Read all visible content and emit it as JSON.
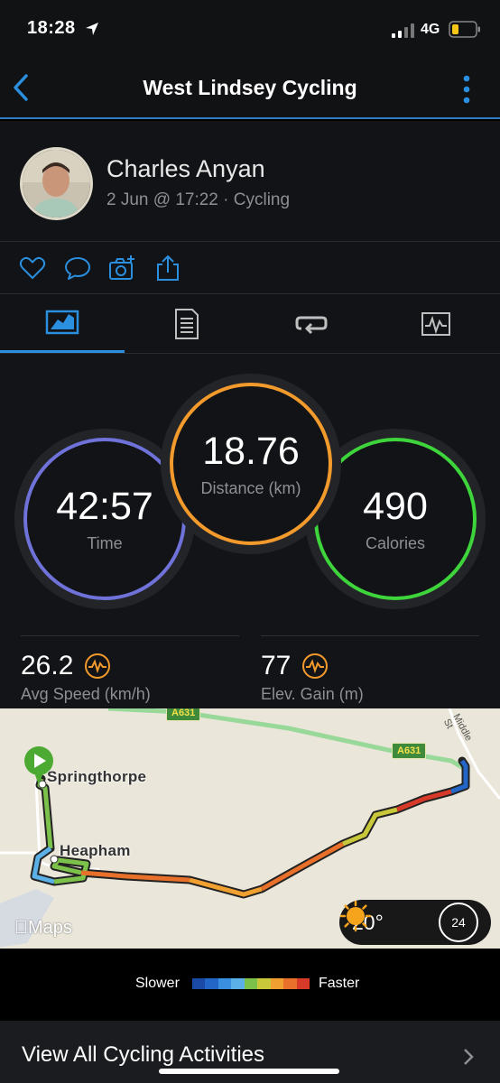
{
  "status_bar": {
    "time": "18:28",
    "network": "4G"
  },
  "nav": {
    "title": "West Lindsey Cycling"
  },
  "profile": {
    "name": "Charles Anyan",
    "meta": "2 Jun @ 17:22 · Cycling"
  },
  "actions": [
    {
      "icon": "heart-icon"
    },
    {
      "icon": "comment-icon"
    },
    {
      "icon": "add-photo-icon"
    },
    {
      "icon": "share-icon"
    }
  ],
  "tabs": [
    {
      "icon": "overview-icon",
      "active": true
    },
    {
      "icon": "details-icon",
      "active": false
    },
    {
      "icon": "laps-icon",
      "active": false
    },
    {
      "icon": "charts-icon",
      "active": false
    }
  ],
  "stats": {
    "time": {
      "value": "42:57",
      "label": "Time",
      "color": "#6b6fd6"
    },
    "distance": {
      "value": "18.76",
      "label": "Distance (km)",
      "color": "#f39a2c"
    },
    "calories": {
      "value": "490",
      "label": "Calories",
      "color": "#3ed43b"
    }
  },
  "metrics": {
    "avg_speed": {
      "value": "26.2",
      "label": "Avg Speed (km/h)"
    },
    "elev_gain": {
      "value": "77",
      "label": "Elev. Gain (m)"
    }
  },
  "map": {
    "place_1": "Springthorpe",
    "place_2": "Heapham",
    "road_1": "A631",
    "road_2": "A631",
    "street": "Middle St",
    "attribution": "Maps",
    "weather_temp": "20°",
    "wind": "24"
  },
  "legend": {
    "slower": "Slower",
    "faster": "Faster",
    "colors": [
      "#1a4aa6",
      "#2466c8",
      "#3a8fe0",
      "#5cb0e8",
      "#7cc24a",
      "#c8c83a",
      "#f0a030",
      "#e8702a",
      "#d83a2a"
    ]
  },
  "footer": {
    "view_all": "View All Cycling Activities"
  }
}
